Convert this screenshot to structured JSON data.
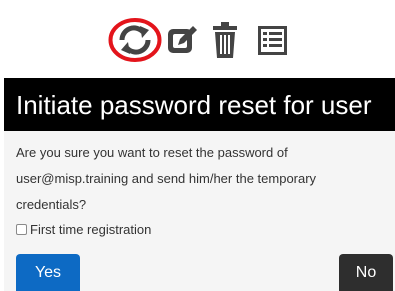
{
  "toolbar": {
    "icons": [
      "sync-icon",
      "edit-icon",
      "trash-icon",
      "list-icon"
    ],
    "highlight_color": "#e3141b",
    "icon_color": "#444444"
  },
  "modal": {
    "title": "Initiate password reset for user",
    "message": "Are you sure you want to reset the password of user@misp.training and send him/her the temporary credentials?",
    "checkbox_label": "First time registration",
    "checkbox_checked": false,
    "yes_label": "Yes",
    "no_label": "No",
    "colors": {
      "header_bg": "#000000",
      "body_bg": "#f5f5f5",
      "yes_bg": "#0d6ac4",
      "no_bg": "#2e2e2e"
    }
  }
}
